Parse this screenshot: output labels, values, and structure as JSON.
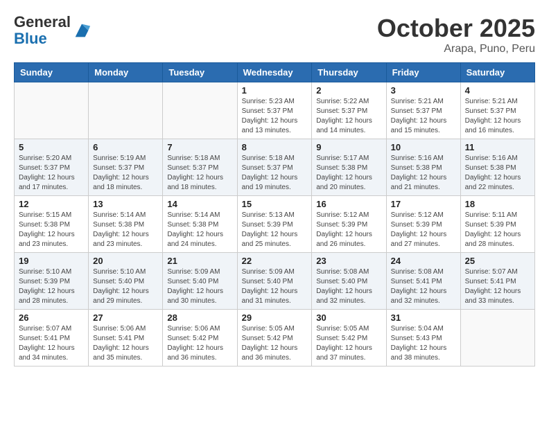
{
  "header": {
    "logo_general": "General",
    "logo_blue": "Blue",
    "month_title": "October 2025",
    "location": "Arapa, Puno, Peru"
  },
  "days_of_week": [
    "Sunday",
    "Monday",
    "Tuesday",
    "Wednesday",
    "Thursday",
    "Friday",
    "Saturday"
  ],
  "weeks": [
    [
      {
        "day": "",
        "info": ""
      },
      {
        "day": "",
        "info": ""
      },
      {
        "day": "",
        "info": ""
      },
      {
        "day": "1",
        "info": "Sunrise: 5:23 AM\nSunset: 5:37 PM\nDaylight: 12 hours\nand 13 minutes."
      },
      {
        "day": "2",
        "info": "Sunrise: 5:22 AM\nSunset: 5:37 PM\nDaylight: 12 hours\nand 14 minutes."
      },
      {
        "day": "3",
        "info": "Sunrise: 5:21 AM\nSunset: 5:37 PM\nDaylight: 12 hours\nand 15 minutes."
      },
      {
        "day": "4",
        "info": "Sunrise: 5:21 AM\nSunset: 5:37 PM\nDaylight: 12 hours\nand 16 minutes."
      }
    ],
    [
      {
        "day": "5",
        "info": "Sunrise: 5:20 AM\nSunset: 5:37 PM\nDaylight: 12 hours\nand 17 minutes."
      },
      {
        "day": "6",
        "info": "Sunrise: 5:19 AM\nSunset: 5:37 PM\nDaylight: 12 hours\nand 18 minutes."
      },
      {
        "day": "7",
        "info": "Sunrise: 5:18 AM\nSunset: 5:37 PM\nDaylight: 12 hours\nand 18 minutes."
      },
      {
        "day": "8",
        "info": "Sunrise: 5:18 AM\nSunset: 5:37 PM\nDaylight: 12 hours\nand 19 minutes."
      },
      {
        "day": "9",
        "info": "Sunrise: 5:17 AM\nSunset: 5:38 PM\nDaylight: 12 hours\nand 20 minutes."
      },
      {
        "day": "10",
        "info": "Sunrise: 5:16 AM\nSunset: 5:38 PM\nDaylight: 12 hours\nand 21 minutes."
      },
      {
        "day": "11",
        "info": "Sunrise: 5:16 AM\nSunset: 5:38 PM\nDaylight: 12 hours\nand 22 minutes."
      }
    ],
    [
      {
        "day": "12",
        "info": "Sunrise: 5:15 AM\nSunset: 5:38 PM\nDaylight: 12 hours\nand 23 minutes."
      },
      {
        "day": "13",
        "info": "Sunrise: 5:14 AM\nSunset: 5:38 PM\nDaylight: 12 hours\nand 23 minutes."
      },
      {
        "day": "14",
        "info": "Sunrise: 5:14 AM\nSunset: 5:38 PM\nDaylight: 12 hours\nand 24 minutes."
      },
      {
        "day": "15",
        "info": "Sunrise: 5:13 AM\nSunset: 5:39 PM\nDaylight: 12 hours\nand 25 minutes."
      },
      {
        "day": "16",
        "info": "Sunrise: 5:12 AM\nSunset: 5:39 PM\nDaylight: 12 hours\nand 26 minutes."
      },
      {
        "day": "17",
        "info": "Sunrise: 5:12 AM\nSunset: 5:39 PM\nDaylight: 12 hours\nand 27 minutes."
      },
      {
        "day": "18",
        "info": "Sunrise: 5:11 AM\nSunset: 5:39 PM\nDaylight: 12 hours\nand 28 minutes."
      }
    ],
    [
      {
        "day": "19",
        "info": "Sunrise: 5:10 AM\nSunset: 5:39 PM\nDaylight: 12 hours\nand 28 minutes."
      },
      {
        "day": "20",
        "info": "Sunrise: 5:10 AM\nSunset: 5:40 PM\nDaylight: 12 hours\nand 29 minutes."
      },
      {
        "day": "21",
        "info": "Sunrise: 5:09 AM\nSunset: 5:40 PM\nDaylight: 12 hours\nand 30 minutes."
      },
      {
        "day": "22",
        "info": "Sunrise: 5:09 AM\nSunset: 5:40 PM\nDaylight: 12 hours\nand 31 minutes."
      },
      {
        "day": "23",
        "info": "Sunrise: 5:08 AM\nSunset: 5:40 PM\nDaylight: 12 hours\nand 32 minutes."
      },
      {
        "day": "24",
        "info": "Sunrise: 5:08 AM\nSunset: 5:41 PM\nDaylight: 12 hours\nand 32 minutes."
      },
      {
        "day": "25",
        "info": "Sunrise: 5:07 AM\nSunset: 5:41 PM\nDaylight: 12 hours\nand 33 minutes."
      }
    ],
    [
      {
        "day": "26",
        "info": "Sunrise: 5:07 AM\nSunset: 5:41 PM\nDaylight: 12 hours\nand 34 minutes."
      },
      {
        "day": "27",
        "info": "Sunrise: 5:06 AM\nSunset: 5:41 PM\nDaylight: 12 hours\nand 35 minutes."
      },
      {
        "day": "28",
        "info": "Sunrise: 5:06 AM\nSunset: 5:42 PM\nDaylight: 12 hours\nand 36 minutes."
      },
      {
        "day": "29",
        "info": "Sunrise: 5:05 AM\nSunset: 5:42 PM\nDaylight: 12 hours\nand 36 minutes."
      },
      {
        "day": "30",
        "info": "Sunrise: 5:05 AM\nSunset: 5:42 PM\nDaylight: 12 hours\nand 37 minutes."
      },
      {
        "day": "31",
        "info": "Sunrise: 5:04 AM\nSunset: 5:43 PM\nDaylight: 12 hours\nand 38 minutes."
      },
      {
        "day": "",
        "info": ""
      }
    ]
  ]
}
